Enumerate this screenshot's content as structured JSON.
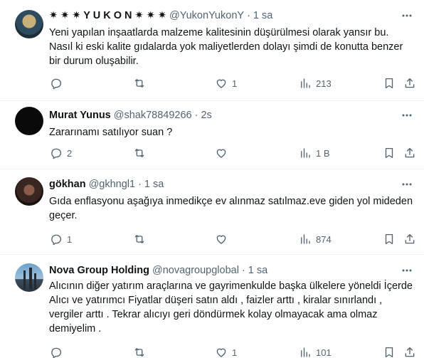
{
  "tweets": [
    {
      "name": "✷ ✷ ✷ Y U K O N ✷ ✷ ✷",
      "handle": "@YukonYukonY",
      "dot": "·",
      "time": "1 sa",
      "text": "Yeni yapılan inşaatlarda malzeme kalitesinin düşürülmesi olarak yansır bu. Nasıl ki eski kalite gıdalarda yok maliyetlerden dolayı şimdi de konutta benzer bir durum oluşabilir.",
      "replies": "",
      "retweets": "",
      "likes": "1",
      "views": "213"
    },
    {
      "name": "Murat Yunus",
      "handle": "@shak78849266",
      "dot": "·",
      "time": "2s",
      "text": "Zararınamı satılıyor suan ?",
      "replies": "2",
      "retweets": "",
      "likes": "",
      "views": "1 B"
    },
    {
      "name": "gökhan",
      "handle": "@gkhngl1",
      "dot": "·",
      "time": "1 sa",
      "text": "Gıda enflasyonu aşağıya inmedikçe ev alınmaz satılmaz.eve giden yol mideden geçer.",
      "replies": "1",
      "retweets": "",
      "likes": "",
      "views": "874"
    },
    {
      "name": "Nova Group Holding",
      "handle": "@novagroupglobal",
      "dot": "·",
      "time": "1 sa",
      "text": "Alıcının diğer yatırım araçlarına ve gayrimenkulde başka ülkelere yöneldi İçerde Alıcı ve yatırımcı Fiyatlar düşeri satın aldı , faizler arttı , kiralar sınırlandı , vergiler arttı . Tekrar alıcıyı geri döndürmek kolay olmayacak ama olmaz demiyelim .",
      "replies": "",
      "retweets": "",
      "likes": "1",
      "views": "101"
    }
  ],
  "icons": {
    "more": "more-dots-icon",
    "reply": "reply-bubble-icon",
    "retweet": "retweet-icon",
    "like": "heart-icon",
    "views": "views-bar-chart-icon",
    "bookmark": "bookmark-icon",
    "share": "share-upload-icon"
  },
  "colors": {
    "text": "#0f1419",
    "secondary": "#536471",
    "divider": "#eff3f4"
  }
}
